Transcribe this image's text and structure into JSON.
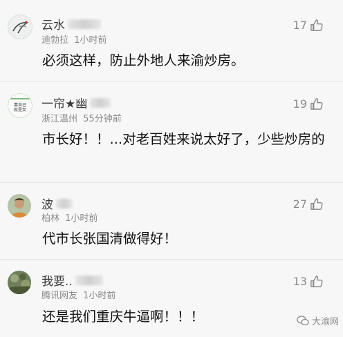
{
  "comments": [
    {
      "name": "云水",
      "location": "迪勃拉",
      "time": "1小时前",
      "likes": "17",
      "text": "必须这样，防止外地人来渝炒房。",
      "avatar": "ink-crane-avatar"
    },
    {
      "name": "一帘★幽",
      "location": "浙江温州",
      "time": "55分钟前",
      "likes": "19",
      "text": "市长好！！...对老百姓来说太好了，少些炒房的",
      "avatar": "text-card-avatar",
      "avatar_text": [
        "靠自己",
        "就是女"
      ]
    },
    {
      "name": "波",
      "location": "柏林",
      "time": "1小时前",
      "likes": "27",
      "text": "代市长张国清做得好！",
      "avatar": "person-photo-avatar"
    },
    {
      "name": "我要..",
      "location": "腾讯网友",
      "time": "1小时前",
      "likes": "13",
      "text": "还是我们重庆牛逼啊！！！",
      "avatar": "landscape-photo-avatar"
    }
  ],
  "watermark": {
    "label": "大渝网"
  }
}
